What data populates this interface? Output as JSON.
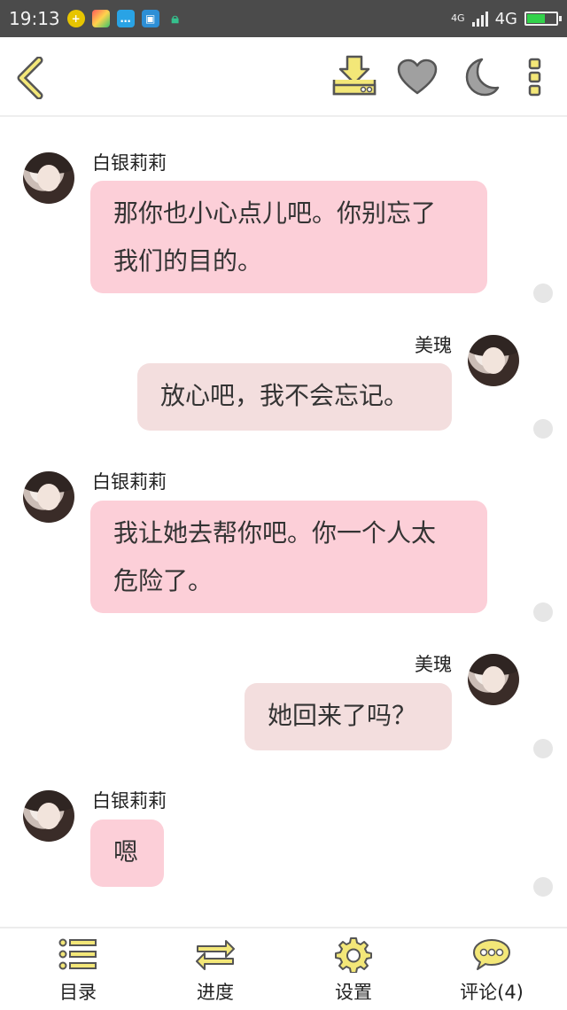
{
  "status_bar": {
    "time": "19:13",
    "network_small": "4G",
    "network": "4G",
    "app_icons": [
      "plus-icon",
      "gallery-icon",
      "chat-icon",
      "scan-icon",
      "lock-icon"
    ]
  },
  "toolbar": {
    "back": "chevron-left-icon",
    "download": "download-icon",
    "favorite": "heart-icon",
    "night_mode": "moon-icon",
    "more": "more-vertical-icon"
  },
  "messages": [
    {
      "side": "left",
      "sender": "白银莉莉",
      "lines": [
        "那你也小心点儿吧。你别忘了",
        "我们的目的。"
      ]
    },
    {
      "side": "right",
      "sender": "美瑰",
      "lines": [
        "放心吧，我不会忘记。"
      ]
    },
    {
      "side": "left",
      "sender": "白银莉莉",
      "lines": [
        "我让她去帮你吧。你一个人太",
        "危险了。"
      ]
    },
    {
      "side": "right",
      "sender": "美瑰",
      "lines": [
        "她回来了吗？"
      ]
    },
    {
      "side": "left",
      "sender": "白银莉莉",
      "lines": [
        "嗯"
      ]
    }
  ],
  "bottom_nav": {
    "items": [
      {
        "label": "目录",
        "icon": "list-icon"
      },
      {
        "label": "进度",
        "icon": "arrows-swap-icon"
      },
      {
        "label": "设置",
        "icon": "gear-icon"
      },
      {
        "label": "评论(4)",
        "icon": "comment-bubble-icon"
      }
    ]
  },
  "colors": {
    "accent_yellow": "#f3e778",
    "icon_stroke": "#555555",
    "left_bubble": "#fccfd8",
    "right_bubble": "#f3dede",
    "status_bar": "#4b4b4b"
  }
}
